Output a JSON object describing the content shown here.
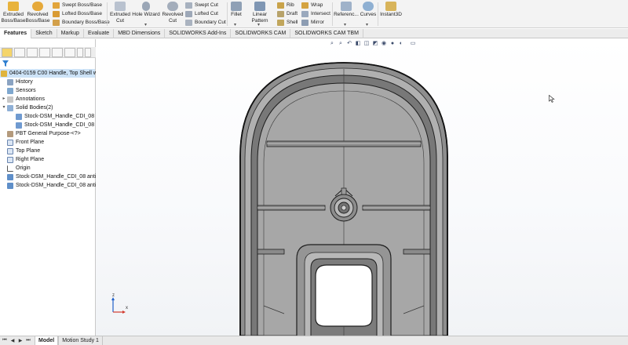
{
  "ribbon": {
    "extruded_boss": "Extruded Boss/Base",
    "revolved_boss": "Revolved Boss/Base",
    "swept_boss": "Swept Boss/Base",
    "lofted_boss": "Lofted Boss/Base",
    "boundary_boss": "Boundary Boss/Base",
    "extruded_cut": "Extruded Cut",
    "hole_wizard": "Hole Wizard",
    "revolved_cut": "Revolved Cut",
    "swept_cut": "Swept Cut",
    "lofted_cut": "Lofted Cut",
    "boundary_cut": "Boundary Cut",
    "fillet": "Fillet",
    "linear_pattern": "Linear Pattern",
    "rib": "Rib",
    "draft": "Draft",
    "shell": "Shell",
    "wrap": "Wrap",
    "intersect": "Intersect",
    "mirror": "Mirror",
    "reference": "Referenc...",
    "curves": "Curves",
    "instant3d": "Instant3D"
  },
  "tabs": [
    {
      "label": "Features"
    },
    {
      "label": "Sketch"
    },
    {
      "label": "Markup"
    },
    {
      "label": "Evaluate"
    },
    {
      "label": "MBD Dimensions"
    },
    {
      "label": "SOLIDWORKS Add-Ins"
    },
    {
      "label": "SOLIDWORKS CAM"
    },
    {
      "label": "SOLIDWORKS CAM TBM"
    }
  ],
  "tree": {
    "root": "0404-0159 C00 Handle, Top Shell wit",
    "history": "History",
    "sensors": "Sensors",
    "annotations": "Annotations",
    "solid_bodies": "Solid Bodies(2)",
    "body1": "Stock-DSM_Handle_CDI_08 ar",
    "body2": "Stock-DSM_Handle_CDI_08 ar",
    "material": "PBT General Purpose-<?>",
    "front_plane": "Front Plane",
    "top_plane": "Top Plane",
    "right_plane": "Right Plane",
    "origin": "Origin",
    "feature1": "Stock-DSM_Handle_CDI_08 anti n",
    "feature2": "Stock-DSM_Handle_CDI_08 anti n"
  },
  "triad": {
    "z": "z",
    "x": "x"
  },
  "bottom_tabs": [
    {
      "label": "Model"
    },
    {
      "label": "Motion Study 1"
    }
  ],
  "colors": {
    "ribbon_bg": "#f3f3f3",
    "selection": "#cde3f7",
    "model_face": "#a7a7a7",
    "model_edge": "#1e1e1e"
  }
}
